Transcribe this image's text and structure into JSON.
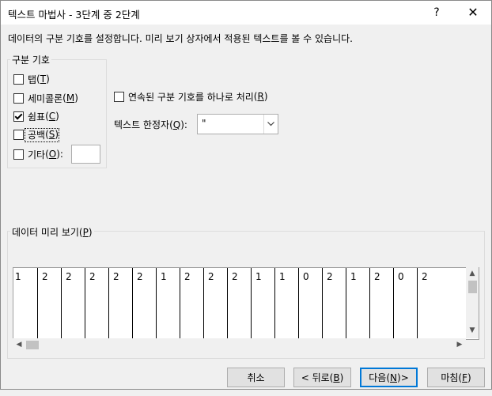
{
  "window": {
    "title": "텍스트 마법사 - 3단계 중 2단계",
    "help_label": "?",
    "close_label": "✕"
  },
  "description": "데이터의 구분 기호를 설정합니다. 미리 보기 상자에서 적용된 텍스트를 볼 수 있습니다.",
  "delimiters": {
    "legend": "구분 기호",
    "items": [
      {
        "label": "탭",
        "key": "T",
        "checked": false
      },
      {
        "label": "세미콜론",
        "key": "M",
        "checked": false
      },
      {
        "label": "쉼표",
        "key": "C",
        "checked": true
      },
      {
        "label": "공백",
        "key": "S",
        "checked": false
      },
      {
        "label": "기타",
        "key": "O",
        "suffix": ":",
        "checked": false
      }
    ],
    "other_value": ""
  },
  "consecutive": {
    "label": "연속된 구분 기호를 하나로 처리",
    "key": "R",
    "checked": false
  },
  "qualifier": {
    "label": "텍스트 한정자",
    "key": "Q",
    "suffix": ":",
    "value": "\""
  },
  "preview": {
    "legend": "데이터 미리 보기",
    "key": "P",
    "columns": [
      "1",
      "2",
      "2",
      "2",
      "2",
      "2",
      "1",
      "2",
      "2",
      "2",
      "1",
      "1",
      "0",
      "2",
      "1",
      "2",
      "0",
      "2"
    ]
  },
  "buttons": {
    "cancel": "취소",
    "back": {
      "label": "< 뒤로",
      "key": "B"
    },
    "next": {
      "label": "다음",
      "key": "N",
      "suffix": " >"
    },
    "finish": {
      "label": "마침",
      "key": "F"
    }
  }
}
